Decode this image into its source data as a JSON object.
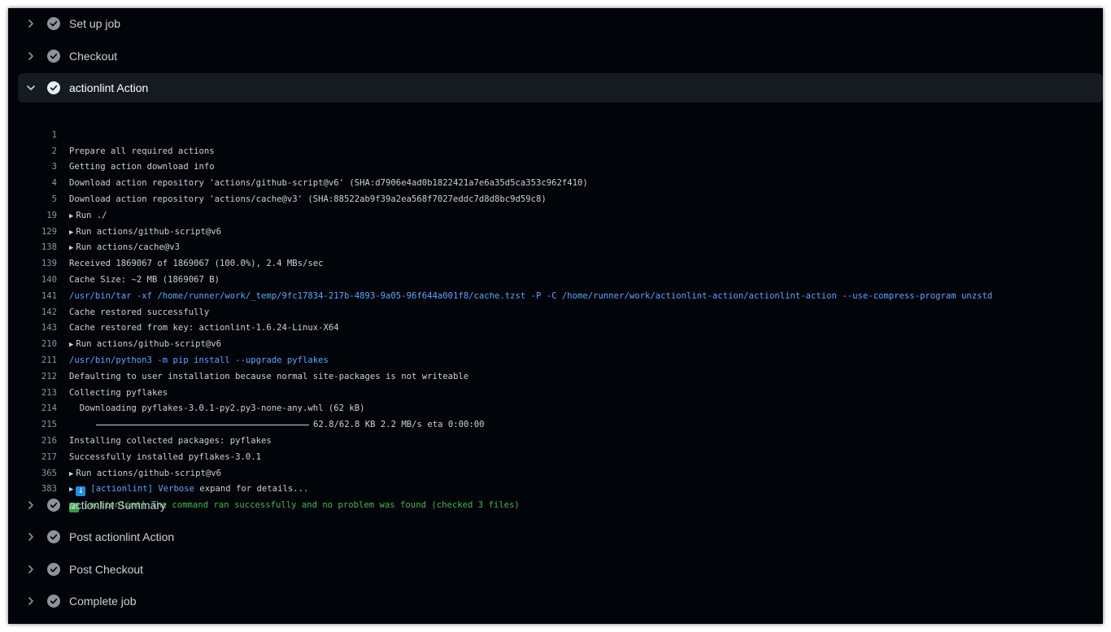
{
  "steps_before": [
    {
      "label": "Set up job"
    },
    {
      "label": "Checkout"
    }
  ],
  "expanded_step": {
    "label": "actionlint Action"
  },
  "steps_after": [
    {
      "label": "actionlint Summary"
    },
    {
      "label": "Post actionlint Action"
    },
    {
      "label": "Post Checkout"
    },
    {
      "label": "Complete job"
    }
  ],
  "log": [
    {
      "num": "1",
      "text": "Prepare all required actions"
    },
    {
      "num": "2",
      "text": "Getting action download info"
    },
    {
      "num": "3",
      "text": "Download action repository 'actions/github-script@v6' (SHA:d7906e4ad0b1822421a7e6a35d5ca353c962f410)"
    },
    {
      "num": "4",
      "text": "Download action repository 'actions/cache@v3' (SHA:88522ab9f39a2ea568f7027eddc7d8d8bc9d59c8)"
    },
    {
      "num": "5",
      "text": "Run ./"
    },
    {
      "num": "19",
      "text": "Run actions/github-script@v6"
    },
    {
      "num": "129",
      "text": "Run actions/cache@v3"
    },
    {
      "num": "138",
      "text": "Received 1869067 of 1869067 (100.0%), 2.4 MBs/sec"
    },
    {
      "num": "139",
      "text": "Cache Size: ~2 MB (1869067 B)"
    },
    {
      "num": "140",
      "text": "/usr/bin/tar -xf /home/runner/work/_temp/9fc17834-217b-4893-9a05-96f644a001f8/cache.tzst -P -C /home/runner/work/actionlint-action/actionlint-action --use-compress-program unzstd"
    },
    {
      "num": "141",
      "text": "Cache restored successfully"
    },
    {
      "num": "142",
      "text": "Cache restored from key: actionlint-1.6.24-Linux-X64"
    },
    {
      "num": "143",
      "text": "Run actions/github-script@v6"
    },
    {
      "num": "210",
      "text": "/usr/bin/python3 -m pip install --upgrade pyflakes"
    },
    {
      "num": "211",
      "text": "Defaulting to user installation because normal site-packages is not writeable"
    },
    {
      "num": "212",
      "text": "Collecting pyflakes"
    },
    {
      "num": "213",
      "text": "  Downloading pyflakes-3.0.1-py2.py3-none-any.whl (62 kB)"
    },
    {
      "num": "214",
      "text": "62.8/62.8 KB 2.2 MB/s eta 0:00:00"
    },
    {
      "num": "215",
      "text": "Installing collected packages: pyflakes"
    },
    {
      "num": "216",
      "text": "Successfully installed pyflakes-3.0.1"
    },
    {
      "num": "217",
      "text": "Run actions/github-script@v6"
    },
    {
      "num": "365",
      "tag": "[actionlint]",
      "bold": "Verbose",
      "text": " expand for details..."
    },
    {
      "num": "383",
      "text": "[actionlint] The command ran successfully and no problem was found (checked 3 files)"
    }
  ],
  "colors": {
    "background": "#010409",
    "expanded_header": "#161b22",
    "text": "#c9d1d9",
    "line_number": "#8b949e",
    "command": "#58a6ff",
    "success": "#3fb950",
    "check_icon": "#8b949e"
  },
  "icons": {
    "collapsed": "chevron-right-icon",
    "expanded": "chevron-down-icon",
    "status": "check-circle-icon",
    "group": "triangle-right-icon",
    "verbose": "down-arrow-emoji-icon",
    "success": "check-mark-emoji-icon"
  }
}
